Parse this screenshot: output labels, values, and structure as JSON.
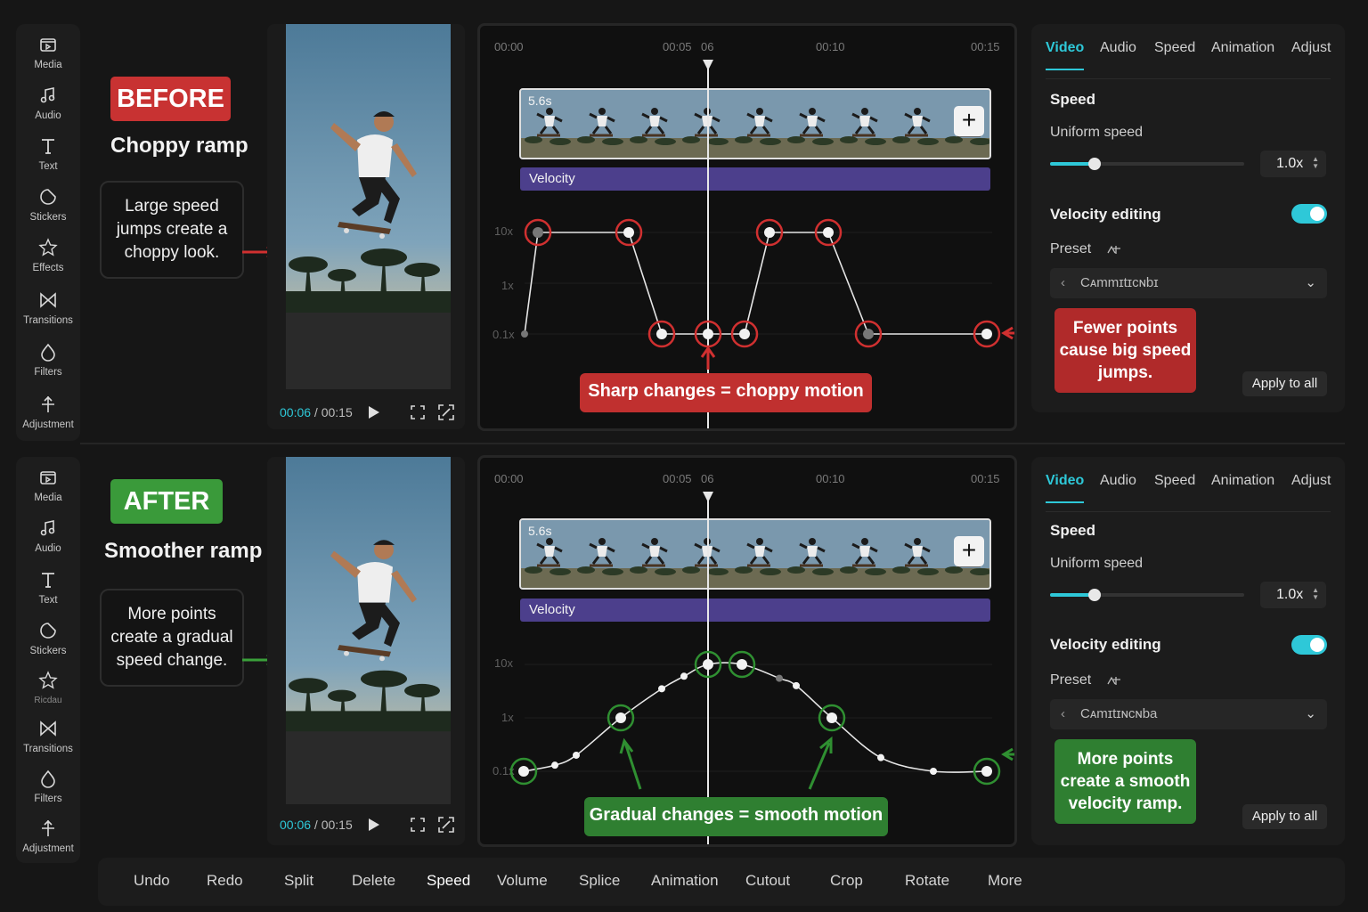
{
  "sidebar": {
    "items": [
      {
        "label": "Media",
        "icon": "media-icon"
      },
      {
        "label": "Audio",
        "icon": "music-note-icon"
      },
      {
        "label": "Text",
        "icon": "text-icon"
      },
      {
        "label": "Stickers",
        "icon": "sticker-icon"
      },
      {
        "label": "Effects",
        "icon": "effects-star-icon"
      },
      {
        "label": "Transitions",
        "icon": "transitions-icon"
      },
      {
        "label": "Filters",
        "icon": "filters-icon"
      },
      {
        "label": "Adjustment",
        "icon": "adjustment-icon"
      }
    ],
    "after_effects_label": "Ricdau"
  },
  "before": {
    "tag": "BEFORE",
    "title": "Choppy ramp",
    "note": "Large speed jumps create a choppy look.",
    "callout_main": "Sharp changes = choppy motion",
    "callout_side": "Fewer points cause big speed jumps.",
    "accent": "#c83232"
  },
  "after": {
    "tag": "AFTER",
    "title": "Smoother ramp",
    "note": "More points create a gradual speed change.",
    "callout_main": "Gradual changes = smooth motion",
    "callout_side": "More points create a smooth velocity ramp.",
    "accent": "#3a9a3a"
  },
  "preview": {
    "current_time": "00:06",
    "separator": " / ",
    "total_time": "00:15"
  },
  "timeline": {
    "ruler": [
      "00:00",
      "00:05",
      "06",
      "00:10",
      "00:15"
    ],
    "clip_duration": "5.6s",
    "velocity_label": "Velocity",
    "axis_labels": [
      "10x",
      "1x",
      "0.1x"
    ]
  },
  "properties": {
    "tabs": [
      "Video",
      "Audio",
      "Speed",
      "Animation",
      "Adjust"
    ],
    "active_tab": "Video",
    "speed_heading": "Speed",
    "uniform_speed_label": "Uniform speed",
    "uniform_speed_value": "1.0x",
    "uniform_speed_level": 0.23,
    "velocity_heading": "Velocity editing",
    "velocity_enabled": true,
    "preset_label": "Preset",
    "preset_value_before": "Cᴀmmɪtɪcɴbɪ",
    "preset_value_after": "Cᴀmɪtɪɴcɴba",
    "apply_all": "Apply to all",
    "accent": "#2ec8d8"
  },
  "toolbar": {
    "items": [
      "Undo",
      "Redo",
      "Split",
      "Delete",
      "Speed",
      "Volume",
      "Splice",
      "Animation",
      "Cutout",
      "Crop",
      "Rotate",
      "More"
    ],
    "active": "Speed"
  }
}
